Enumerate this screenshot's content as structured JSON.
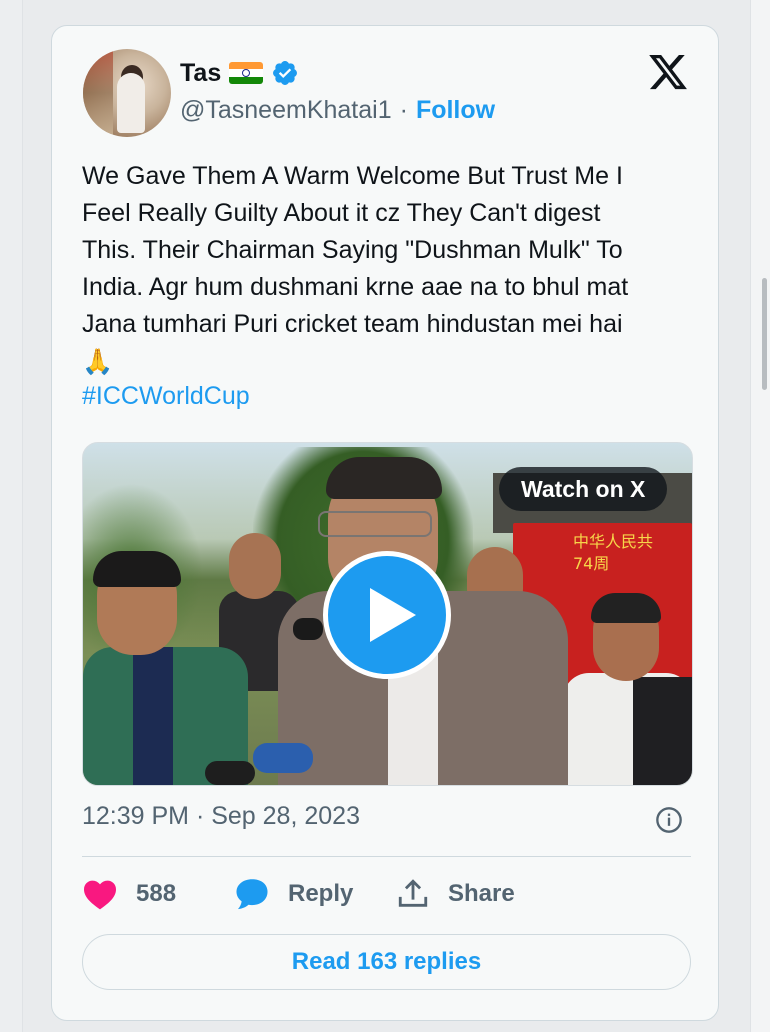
{
  "tweet": {
    "author": {
      "name": "Tas",
      "handle": "@TasneemKhatai1",
      "separator": "·",
      "follow_label": "Follow",
      "flag_icon": "india-flag-icon",
      "verified_icon": "verified-badge-icon",
      "avatar_icon": "profile-avatar"
    },
    "platform_icon": "x-logo-icon",
    "text": "We Gave Them A Warm Welcome But Trust Me I\nFeel Really Guilty About it cz They Can't digest\nThis. Their Chairman Saying \"Dushman Mulk\" To\nIndia. Agr hum dushmani krne aae na to bhul mat\nJana tumhari Puri cricket team hindustan mei hai",
    "emoji": "🙏",
    "hashtag": "#ICCWorldCup",
    "media": {
      "type": "video",
      "watch_label": "Watch on X",
      "banner_text": "中华人民共\n74周"
    },
    "timestamp": "12:39 PM · Sep 28, 2023",
    "likes": "588",
    "reply_label": "Reply",
    "share_label": "Share",
    "read_replies_label": "Read 163 replies"
  },
  "colors": {
    "accent": "#1d9bf0",
    "text": "#0f1419",
    "muted": "#536471",
    "like": "#f91880",
    "card_bg": "#f7f9f9",
    "border": "#cfd9de"
  }
}
